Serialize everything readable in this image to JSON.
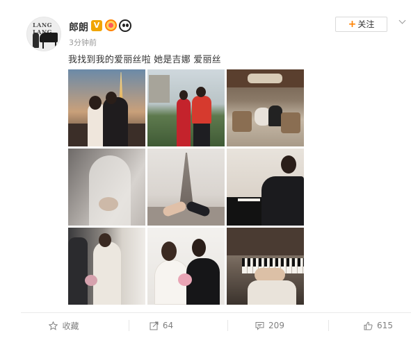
{
  "post": {
    "username": "郎朗",
    "verified_badge": "V",
    "time": "3分钟前",
    "text": "我找到我的爱丽丝啦 她是吉娜 爱丽丝",
    "follow_label": "关注",
    "avatar_logo": "LANG LANG"
  },
  "icons": {
    "verified": "verified-v-icon",
    "medal": "medal-badge-icon",
    "panda": "panda-badge-icon",
    "more": "chevron-down-icon",
    "favorite": "star-icon",
    "share": "share-icon",
    "comment": "comment-icon",
    "like": "thumbs-up-icon"
  },
  "photos": [
    {
      "name": "couple-eiffel-night"
    },
    {
      "name": "couple-red-qipao"
    },
    {
      "name": "paris-cafe-terrace"
    },
    {
      "name": "bride-veil"
    },
    {
      "name": "eiffel-tower-hands"
    },
    {
      "name": "man-playing-piano"
    },
    {
      "name": "bride-window-portrait"
    },
    {
      "name": "couple-wedding-portrait"
    },
    {
      "name": "piano-keys-hands"
    }
  ],
  "actions": {
    "favorite_label": "收藏",
    "share_count": "64",
    "comment_count": "209",
    "like_count": "615"
  },
  "colors": {
    "accent": "#ff8200",
    "verified": "#f0a500",
    "muted_text": "#808080"
  }
}
